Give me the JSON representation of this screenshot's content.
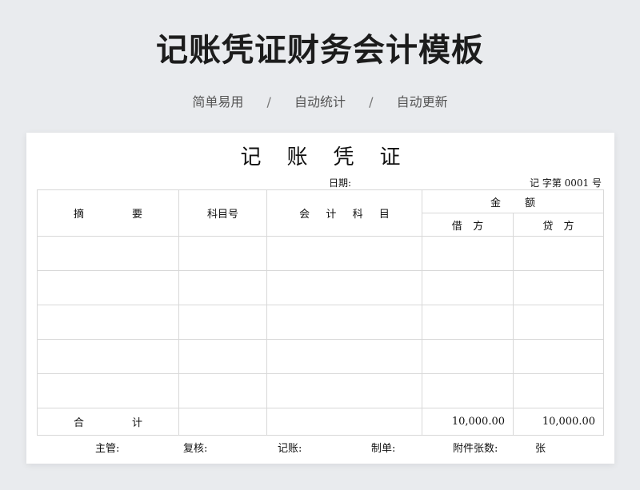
{
  "header": {
    "title": "记账凭证财务会计模板",
    "features": [
      "简单易用",
      "自动统计",
      "自动更新"
    ],
    "separator": "/"
  },
  "voucher": {
    "title_chars": [
      "记",
      "账",
      "凭",
      "证"
    ],
    "date_label": "日期:",
    "number_text": "记 字第 0001 号",
    "columns": {
      "summary": [
        "摘",
        "要"
      ],
      "account_code": "科目号",
      "account_name": [
        "会",
        "计",
        "科",
        "目"
      ],
      "amount": [
        "金",
        "额"
      ],
      "debit": [
        "借",
        "方"
      ],
      "credit": [
        "贷",
        "方"
      ]
    },
    "rows": [
      {
        "summary": "",
        "code": "",
        "account": "",
        "debit": "",
        "credit": ""
      },
      {
        "summary": "",
        "code": "",
        "account": "",
        "debit": "",
        "credit": ""
      },
      {
        "summary": "",
        "code": "",
        "account": "",
        "debit": "",
        "credit": ""
      },
      {
        "summary": "",
        "code": "",
        "account": "",
        "debit": "",
        "credit": ""
      },
      {
        "summary": "",
        "code": "",
        "account": "",
        "debit": "",
        "credit": ""
      }
    ],
    "total": {
      "label": [
        "合",
        "计"
      ],
      "debit": "10,000.00",
      "credit": "10,000.00"
    },
    "signatures": {
      "supervisor": "主管:",
      "reviewer": "复核:",
      "bookkeeper": "记账:",
      "preparer": "制单:",
      "attachments": "附件张数:",
      "attachments_unit": "张"
    }
  }
}
